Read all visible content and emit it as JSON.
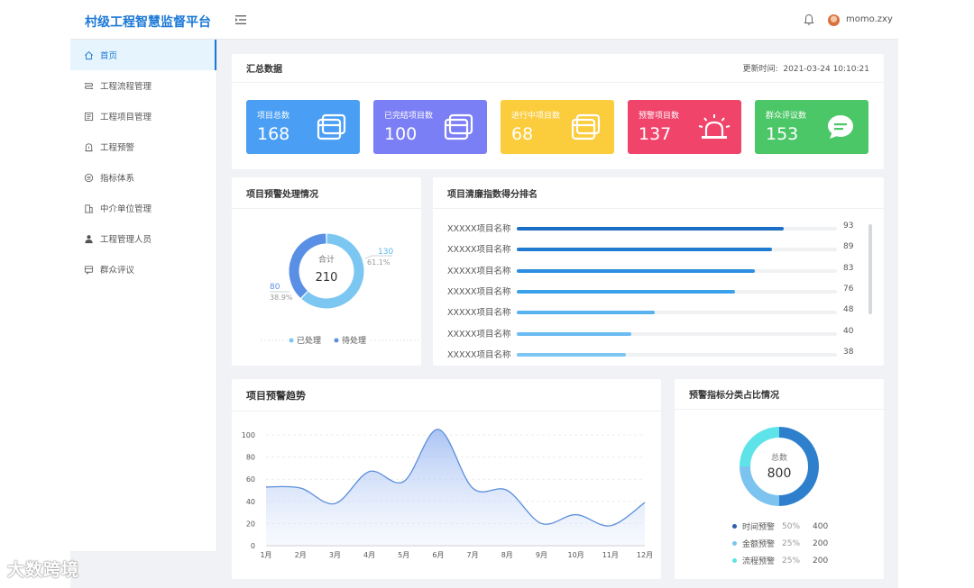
{
  "app": {
    "title": "村级工程智慧监督平台",
    "username": "momo.zxy"
  },
  "sidebar": {
    "items": [
      {
        "label": "首页",
        "icon": "home-icon"
      },
      {
        "label": "工程流程管理",
        "icon": "flow-icon"
      },
      {
        "label": "工程项目管理",
        "icon": "list-icon"
      },
      {
        "label": "工程预警",
        "icon": "warning-icon"
      },
      {
        "label": "指标体系",
        "icon": "index-icon"
      },
      {
        "label": "中介单位管理",
        "icon": "building-icon"
      },
      {
        "label": "工程管理人员",
        "icon": "person-icon"
      },
      {
        "label": "群众评议",
        "icon": "comment-icon"
      }
    ]
  },
  "summary": {
    "title": "汇总数据",
    "update_label": "更新时间:",
    "update_time": "2021-03-24 10:10:21",
    "stats": [
      {
        "label": "项目总数",
        "value": "168",
        "color": "#4a9ff5",
        "icon": "window-icon"
      },
      {
        "label": "已完结项目数",
        "value": "100",
        "color": "#7b7ff5",
        "icon": "window-icon"
      },
      {
        "label": "进行中项目数",
        "value": "68",
        "color": "#fbcc3c",
        "icon": "window-icon"
      },
      {
        "label": "预警项目数",
        "value": "137",
        "color": "#f0446b",
        "icon": "alarm-icon"
      },
      {
        "label": "群众评议数",
        "value": "153",
        "color": "#4cc768",
        "icon": "chat-icon"
      }
    ]
  },
  "handling": {
    "title": "项目预警处理情况",
    "center_label": "合计",
    "center_value": "210",
    "slices": [
      {
        "name": "已处理",
        "value": "130",
        "pct": "61.1%",
        "color": "#7cc7f2"
      },
      {
        "name": "待处理",
        "value": "80",
        "pct": "38.9%",
        "color": "#5a8fe6"
      }
    ]
  },
  "ranking": {
    "title": "项目清廉指数得分排名",
    "rows": [
      {
        "name": "XXXXX项目名称",
        "value": "93",
        "score": 93,
        "color": "#1b6fc4"
      },
      {
        "name": "XXXXX项目名称",
        "value": "89",
        "score": 89,
        "color": "#1f7bd0"
      },
      {
        "name": "XXXXX项目名称",
        "value": "83",
        "score": 83,
        "color": "#2b8ee0"
      },
      {
        "name": "XXXXX项目名称",
        "value": "76",
        "score": 76,
        "color": "#3aa0ea"
      },
      {
        "name": "XXXXX项目名称",
        "value": "48",
        "score": 48,
        "color": "#58b2ef"
      },
      {
        "name": "XXXXX项目名称",
        "value": "40",
        "score": 40,
        "color": "#6bbcf2"
      },
      {
        "name": "XXXXX项目名称",
        "value": "38",
        "score": 38,
        "color": "#7cc5f4"
      }
    ]
  },
  "trend": {
    "title": "项目预警趋势"
  },
  "chart_data": {
    "type": "area",
    "title": "项目预警趋势",
    "categories": [
      "1月",
      "2月",
      "3月",
      "4月",
      "5月",
      "6月",
      "7月",
      "8月",
      "9月",
      "10月",
      "11月",
      "12月"
    ],
    "values": [
      53,
      52,
      38,
      67,
      58,
      105,
      52,
      50,
      20,
      28,
      18,
      39
    ],
    "ylim": [
      0,
      100
    ],
    "yticks": [
      "0",
      "20",
      "40",
      "60",
      "80",
      "100"
    ],
    "grid": true,
    "color": "#5b8fdc"
  },
  "category": {
    "title": "预警指标分类占比情况",
    "center_label": "总数",
    "center_value": "800",
    "items": [
      {
        "name": "时间预警",
        "pct": "50%",
        "value": "400",
        "share": 50,
        "color": "#2e80cc"
      },
      {
        "name": "金额预警",
        "pct": "25%",
        "value": "200",
        "share": 25,
        "color": "#7cc3f0"
      },
      {
        "name": "流程预警",
        "pct": "25%",
        "value": "200",
        "share": 25,
        "color": "#5ee3e8"
      }
    ]
  },
  "watermark": "大数跨境"
}
